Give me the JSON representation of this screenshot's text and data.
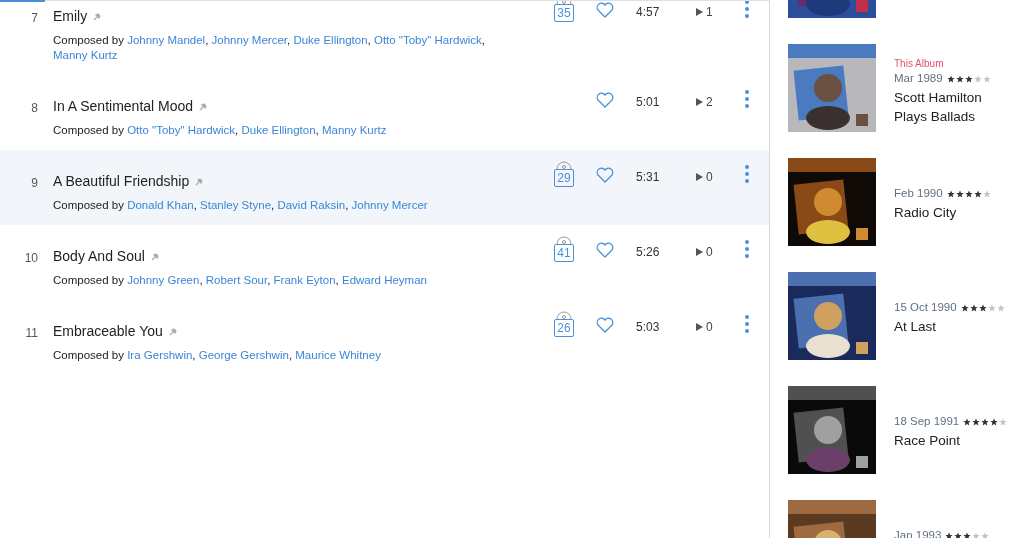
{
  "tracks": [
    {
      "number": "7",
      "title": "Emily",
      "composed_label": "Composed by",
      "separator": ",",
      "composers": [
        "Johnny Mandel",
        "Johnny Mercer",
        "Duke Ellington",
        "Otto \"Toby\" Hardwick",
        "Manny Kurtz"
      ],
      "disc": "35",
      "duration": "4:57",
      "plays": "1",
      "selected": false
    },
    {
      "number": "8",
      "title": "In A Sentimental Mood",
      "composed_label": "Composed by",
      "separator": ",",
      "composers": [
        "Otto \"Toby\" Hardwick",
        "Duke Ellington",
        "Manny Kurtz"
      ],
      "duration": "5:01",
      "plays": "2",
      "selected": false
    },
    {
      "number": "9",
      "title": "A Beautiful Friendship",
      "composed_label": "Composed by",
      "separator": ",",
      "composers": [
        "Donald Khan",
        "Stanley Styne",
        "David Raksin",
        "Johnny Mercer"
      ],
      "disc": "29",
      "duration": "5:31",
      "plays": "0",
      "selected": true
    },
    {
      "number": "10",
      "title": "Body And Soul",
      "composed_label": "Composed by",
      "separator": ",",
      "composers": [
        "Johnny Green",
        "Robert Sour",
        "Frank Eyton",
        "Edward Heyman"
      ],
      "disc": "41",
      "duration": "5:26",
      "plays": "0",
      "selected": false
    },
    {
      "number": "11",
      "title": "Embraceable You",
      "composed_label": "Composed by",
      "separator": ",",
      "composers": [
        "Ira Gershwin",
        "George Gershwin",
        "Maurice Whitney"
      ],
      "disc": "26",
      "duration": "5:03",
      "plays": "0",
      "selected": false
    }
  ],
  "albums": [
    {
      "kind": "picture"
    },
    {
      "kind": "picture",
      "badge": "This Album",
      "date": "Mar 1989",
      "stars": 3,
      "title": "Scott Hamilton Plays Ballads"
    },
    {
      "kind": "picture",
      "date": "Feb 1990",
      "stars": 4,
      "title": "Radio City"
    },
    {
      "kind": "picture",
      "date": "15 Oct 1990",
      "stars": 3,
      "title": "At Last"
    },
    {
      "kind": "picture",
      "date": "18 Sep 1991",
      "stars": 4,
      "title": "Race Point"
    },
    {
      "kind": "picture",
      "date": "Jan 1993",
      "stars": 3
    }
  ]
}
